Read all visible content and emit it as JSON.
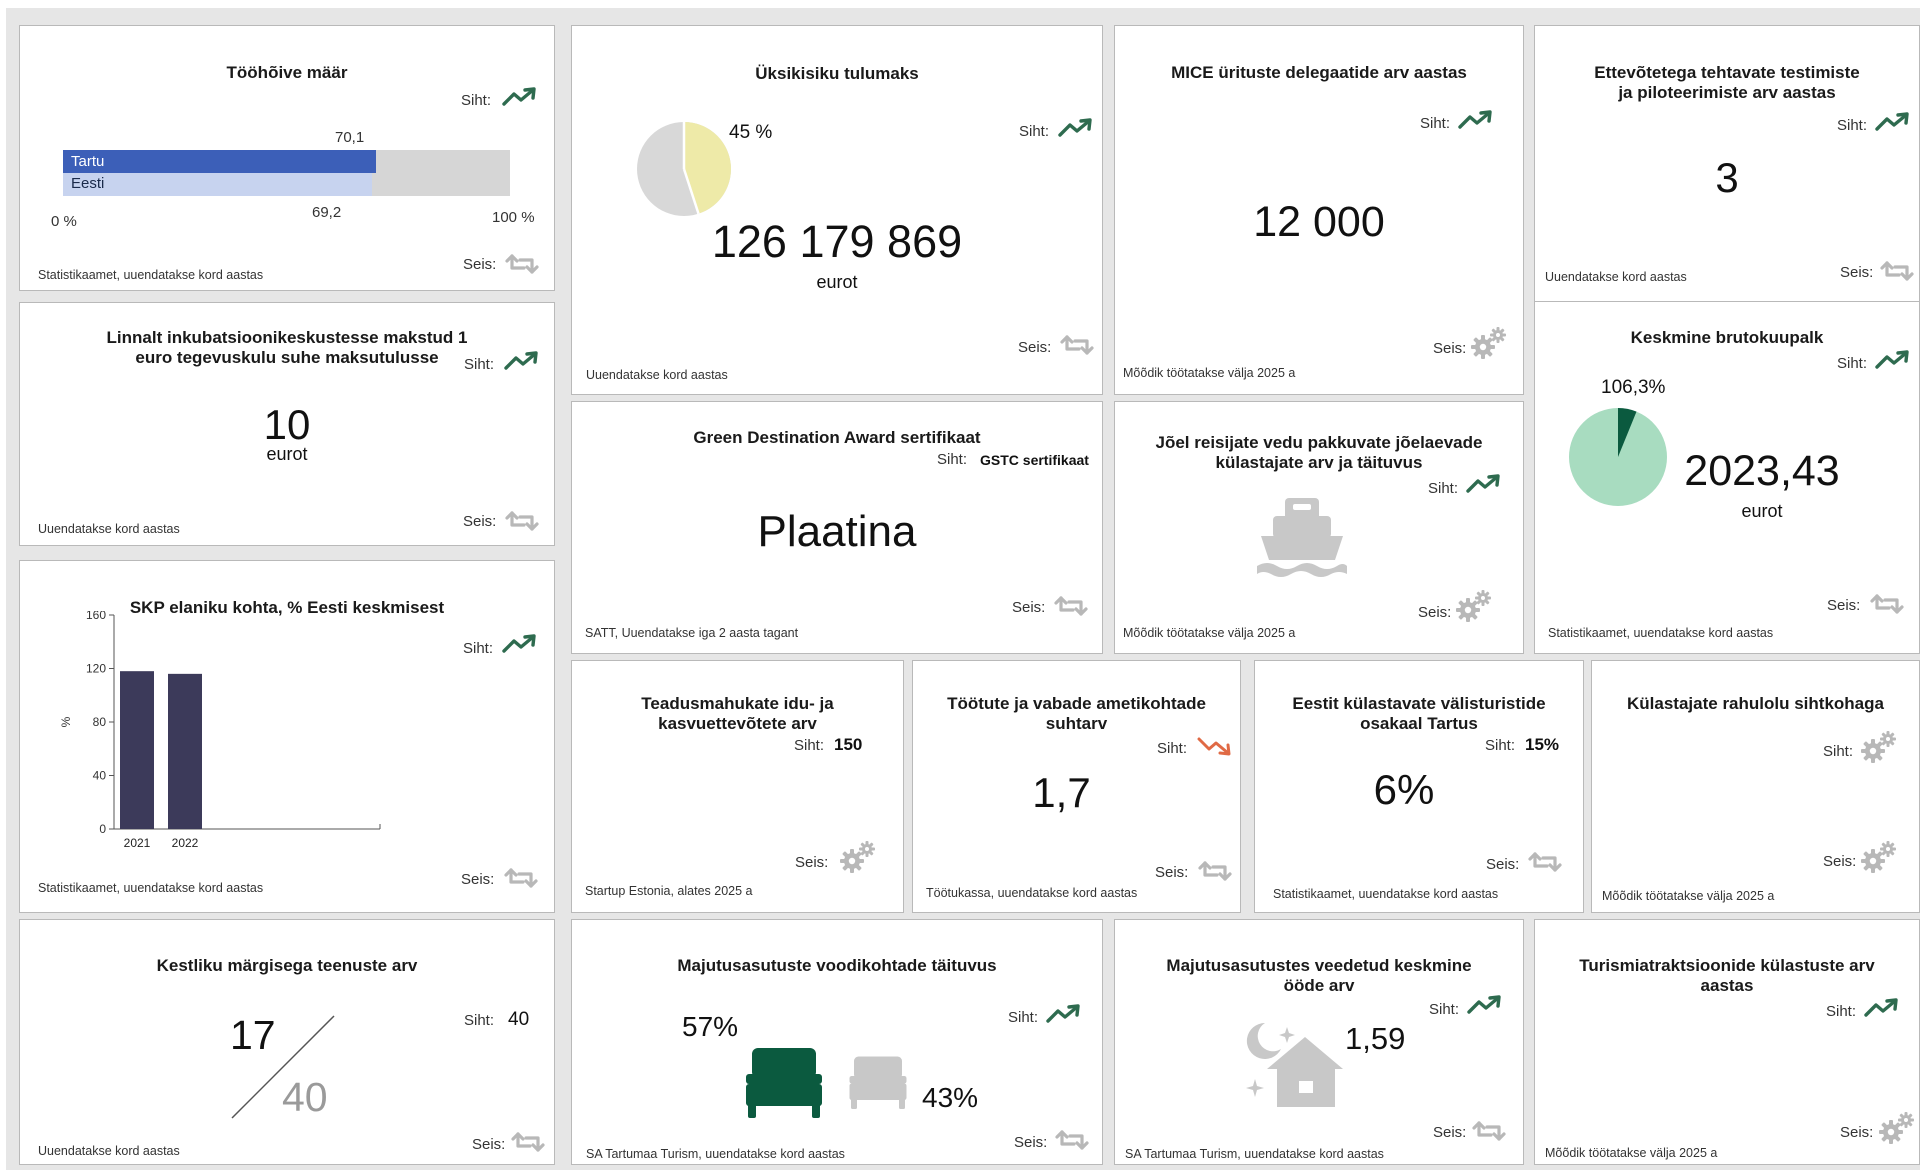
{
  "footers": {
    "stat": "Statistikaamet, uuendatakse kord aastas",
    "yearly": "Uuendatakse kord aastas",
    "dev2025": "Mõõdik töötatakse välja 2025 a",
    "satt": "SATT, Uuendatakse iga 2 aasta tagant",
    "startup": "Startup Estonia, alates 2025 a",
    "tootukassa": "Töötukassa, uuendatakse kord aastas",
    "sa": "SA Tartumaa Turism, uuendatakse kord aastas"
  },
  "labels": {
    "target": "Siht:",
    "status": "Seis:"
  },
  "colors": {
    "up_trend": "#2e6b4f",
    "down_trend": "#e06a45",
    "bar_tartu": "#3c5fb8",
    "bar_eesti": "#c7d3ef",
    "bar_bg": "#d6d6d6",
    "pie_main": "#a8dcc0",
    "pie_dark": "#0b5a3f",
    "bed_green": "#0b5a3f",
    "icon_gray": "#c8c8c8",
    "sgp_bar": "#3c3a5a"
  },
  "cards": {
    "employment": {
      "title": "Tööhõive määr",
      "tartu_value": "70,1",
      "eesti_value": "69,2",
      "tartu_label": "Tartu",
      "eesti_label": "Eesti",
      "axis_min": "0 %",
      "axis_max": "100 %",
      "tartu_frac": 0.701,
      "eesti_frac": 0.692
    },
    "income_tax": {
      "title": "Üksikisiku tulumaks",
      "value": "126 179 869",
      "unit": "eurot",
      "pie_label": "45 %",
      "pie_fraction": 0.45
    },
    "mice": {
      "title": "MICE ürituste delegaatide arv aastas",
      "value": "12 000"
    },
    "testing": {
      "title": "Ettevõtetega tehtavate testimiste ja piloteerimiste arv aastas",
      "value": "3"
    },
    "incubation": {
      "title": "Linnalt inkubatsioonikeskustesse makstud 1 euro tegevuskulu suhe maksutulusse",
      "value": "10",
      "unit": "eurot"
    },
    "green_award": {
      "title": "Green Destination Award sertifikaat",
      "target_value": "GSTC sertifikaat",
      "value": "Plaatina"
    },
    "river": {
      "title": "Jõel reisijate vedu pakkuvate jõelaevade külastajate arv ja täituvus"
    },
    "salary": {
      "title": "Keskmine brutokuupalk",
      "value": "2023,43",
      "unit": "eurot",
      "pie_label": "106,3%",
      "pie_fraction": 0.063
    },
    "gdp": {
      "title": "SKP elaniku kohta, % Eesti keskmisest",
      "chart_data": {
        "type": "bar",
        "categories": [
          "2021",
          "2022"
        ],
        "values": [
          118,
          116
        ],
        "ylabel": "%",
        "yticks": [
          "160",
          "120",
          "80",
          "40",
          "0"
        ],
        "ylim": [
          0,
          160
        ],
        "grid": false
      }
    },
    "research": {
      "title": "Teadusmahukate idu- ja kasvuettevõtete arv",
      "target_value": "150"
    },
    "unemployed": {
      "title": "Töötute ja vabade ametikohtade suhtarv",
      "value": "1,7"
    },
    "foreign": {
      "title": "Eestit külastavate välisturistide osakaal Tartus",
      "target_value": "15%",
      "value": "6%"
    },
    "satisfaction": {
      "title": "Külastajate rahulolu sihtkohaga"
    },
    "sustainable": {
      "title": "Kestliku märgisega teenuste arv",
      "value": "17",
      "total": "40",
      "target_value": "40"
    },
    "beds": {
      "title": "Majutusasutuste voodikohtade täituvus",
      "occupied": "57%",
      "free": "43%"
    },
    "nights": {
      "title": "Majutusasutustes veedetud keskmine ööde arv",
      "value": "1,59"
    },
    "attractions": {
      "title": "Turismiatraktsioonide külastuste arv aastas"
    }
  }
}
